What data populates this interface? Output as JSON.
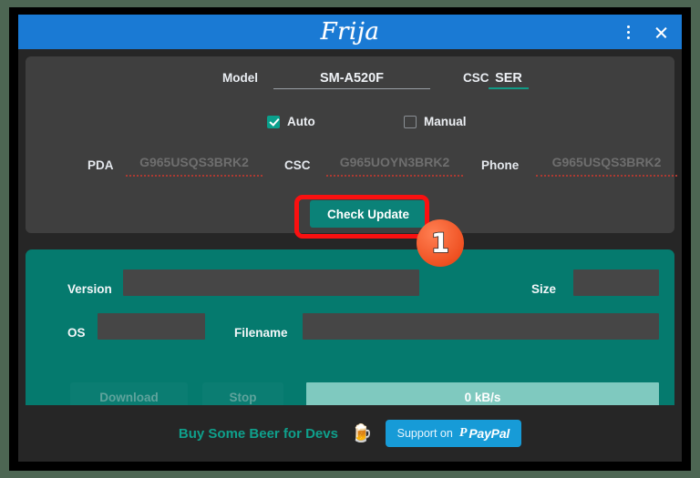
{
  "window": {
    "title": "Frija",
    "menu_icon": "vertical-dots-icon",
    "close_icon": "close-icon"
  },
  "model_panel": {
    "model_label": "Model",
    "model_value": "SM-A520F",
    "csc_label": "CSC",
    "csc_value": "SER",
    "auto_label": "Auto",
    "auto_checked": true,
    "manual_label": "Manual",
    "manual_checked": false,
    "firmware": [
      {
        "label": "PDA",
        "placeholder": "G965USQS3BRK2",
        "value": ""
      },
      {
        "label": "CSC",
        "placeholder": "G965UOYN3BRK2",
        "value": ""
      },
      {
        "label": "Phone",
        "placeholder": "G965USQS3BRK2",
        "value": ""
      }
    ],
    "check_update_label": "Check Update"
  },
  "annotation": {
    "badge_number": "1",
    "highlight_color": "#fa1010",
    "badge_color": "#ef5122"
  },
  "download_panel": {
    "version_label": "Version",
    "version_value": "",
    "size_label": "Size",
    "size_value": "",
    "os_label": "OS",
    "os_value": "",
    "filename_label": "Filename",
    "filename_value": "",
    "download_label": "Download",
    "stop_label": "Stop",
    "progress_text": "0 kB/s",
    "progress_percent": 0
  },
  "footer": {
    "donate_label": "Buy Some Beer for Devs",
    "beer_icon": "beer-mug-icon",
    "paypal_support_label": "Support on",
    "paypal_mark": "P",
    "paypal_word": "PayPal"
  },
  "colors": {
    "titlebar_blue": "#1a7ad4",
    "panel_dark": "#3f3f3f",
    "panel_teal": "#057a6e",
    "accent_teal": "#0aa08c",
    "paypal_blue": "#179bd7"
  }
}
